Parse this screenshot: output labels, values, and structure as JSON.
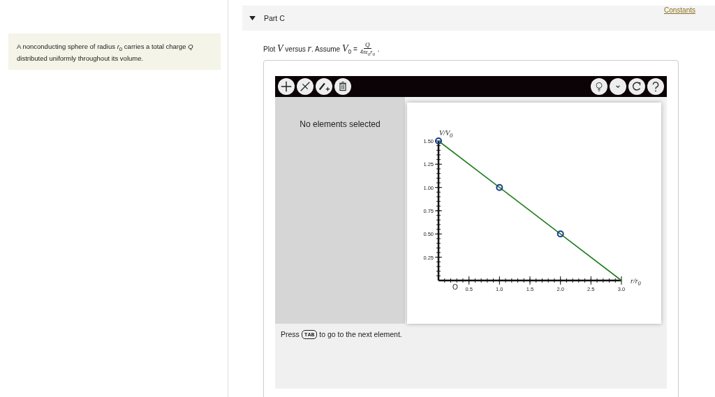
{
  "intro": {
    "text": "A nonconducting sphere of radius *r*$_{0}$ carries a total charge *Q* distributed uniformly throughout its volume."
  },
  "header_links": [
    "Constants"
  ],
  "part": {
    "title": "Part C",
    "expanded": true
  },
  "question": {
    "prefix": "Plot *V* versus *r*. Assume *V*$_{0}$ =",
    "numerator": "*Q*",
    "denominator": "4πε$_{0}$r$_{0}$",
    "suffix": "."
  },
  "tool": {
    "status": "No elements selected",
    "hint_before": "Press",
    "hint_key": "TAB",
    "hint_after": "to go to the next element.",
    "graph": {
      "origin_label": "O",
      "chart_data": {
        "type": "line",
        "xlabel": "*r*/*r*$_{0}$",
        "ylabel": "*V*/*V*$_{0}$",
        "x": [
          0,
          1,
          2,
          3
        ],
        "xlim": [
          0,
          3
        ],
        "ylim": [
          0,
          1.5
        ],
        "xticks": [
          {
            "value": 0.5,
            "label": "0.5"
          },
          {
            "value": 1,
            "label": "1.0"
          },
          {
            "value": 1.5,
            "label": "1.5"
          },
          {
            "value": 2,
            "label": "2.0"
          },
          {
            "value": 2.5,
            "label": "2.5"
          },
          {
            "value": 3,
            "label": "3.0"
          }
        ],
        "yticks": [
          {
            "value": 0.25,
            "label": "0.25"
          },
          {
            "value": 0.5,
            "label": "0.50"
          },
          {
            "value": 0.75,
            "label": "0.75"
          },
          {
            "value": 1,
            "label": "1.00"
          },
          {
            "value": 1.25,
            "label": "1.25"
          },
          {
            "value": 1.5,
            "label": "1.50"
          }
        ],
        "series": [
          {
            "color": "#1e7d1e",
            "values": [
              1.5,
              1.0,
              0.5,
              0
            ]
          }
        ]
      }
    }
  }
}
